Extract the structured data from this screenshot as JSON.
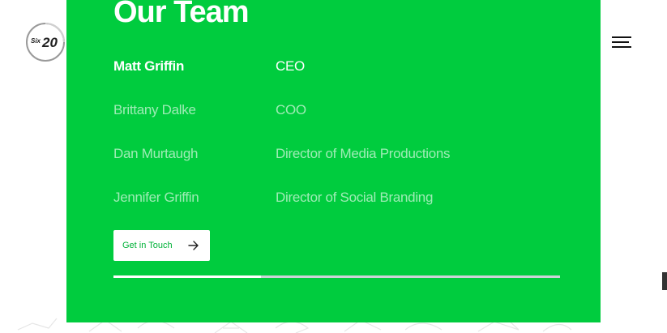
{
  "logo": {
    "text_small": "Six",
    "text_big": "20"
  },
  "header": {
    "menu_icon": "hamburger-menu-icon"
  },
  "team": {
    "title": "Our Team",
    "members": [
      {
        "name": "Matt Griffin",
        "role": "CEO",
        "active": true
      },
      {
        "name": "Brittany Dalke",
        "role": "COO",
        "active": false
      },
      {
        "name": "Dan Murtaugh",
        "role": "Director of Media Productions",
        "active": false
      },
      {
        "name": "Jennifer Griffin",
        "role": "Director of Social Branding",
        "active": false
      }
    ],
    "cta_label": "Get in Touch",
    "cta_icon": "arrow-right-icon",
    "progress": 0.33
  },
  "colors": {
    "accent_green": "#00cc3e",
    "progress_track": "#cdd3d8",
    "white": "#ffffff"
  }
}
